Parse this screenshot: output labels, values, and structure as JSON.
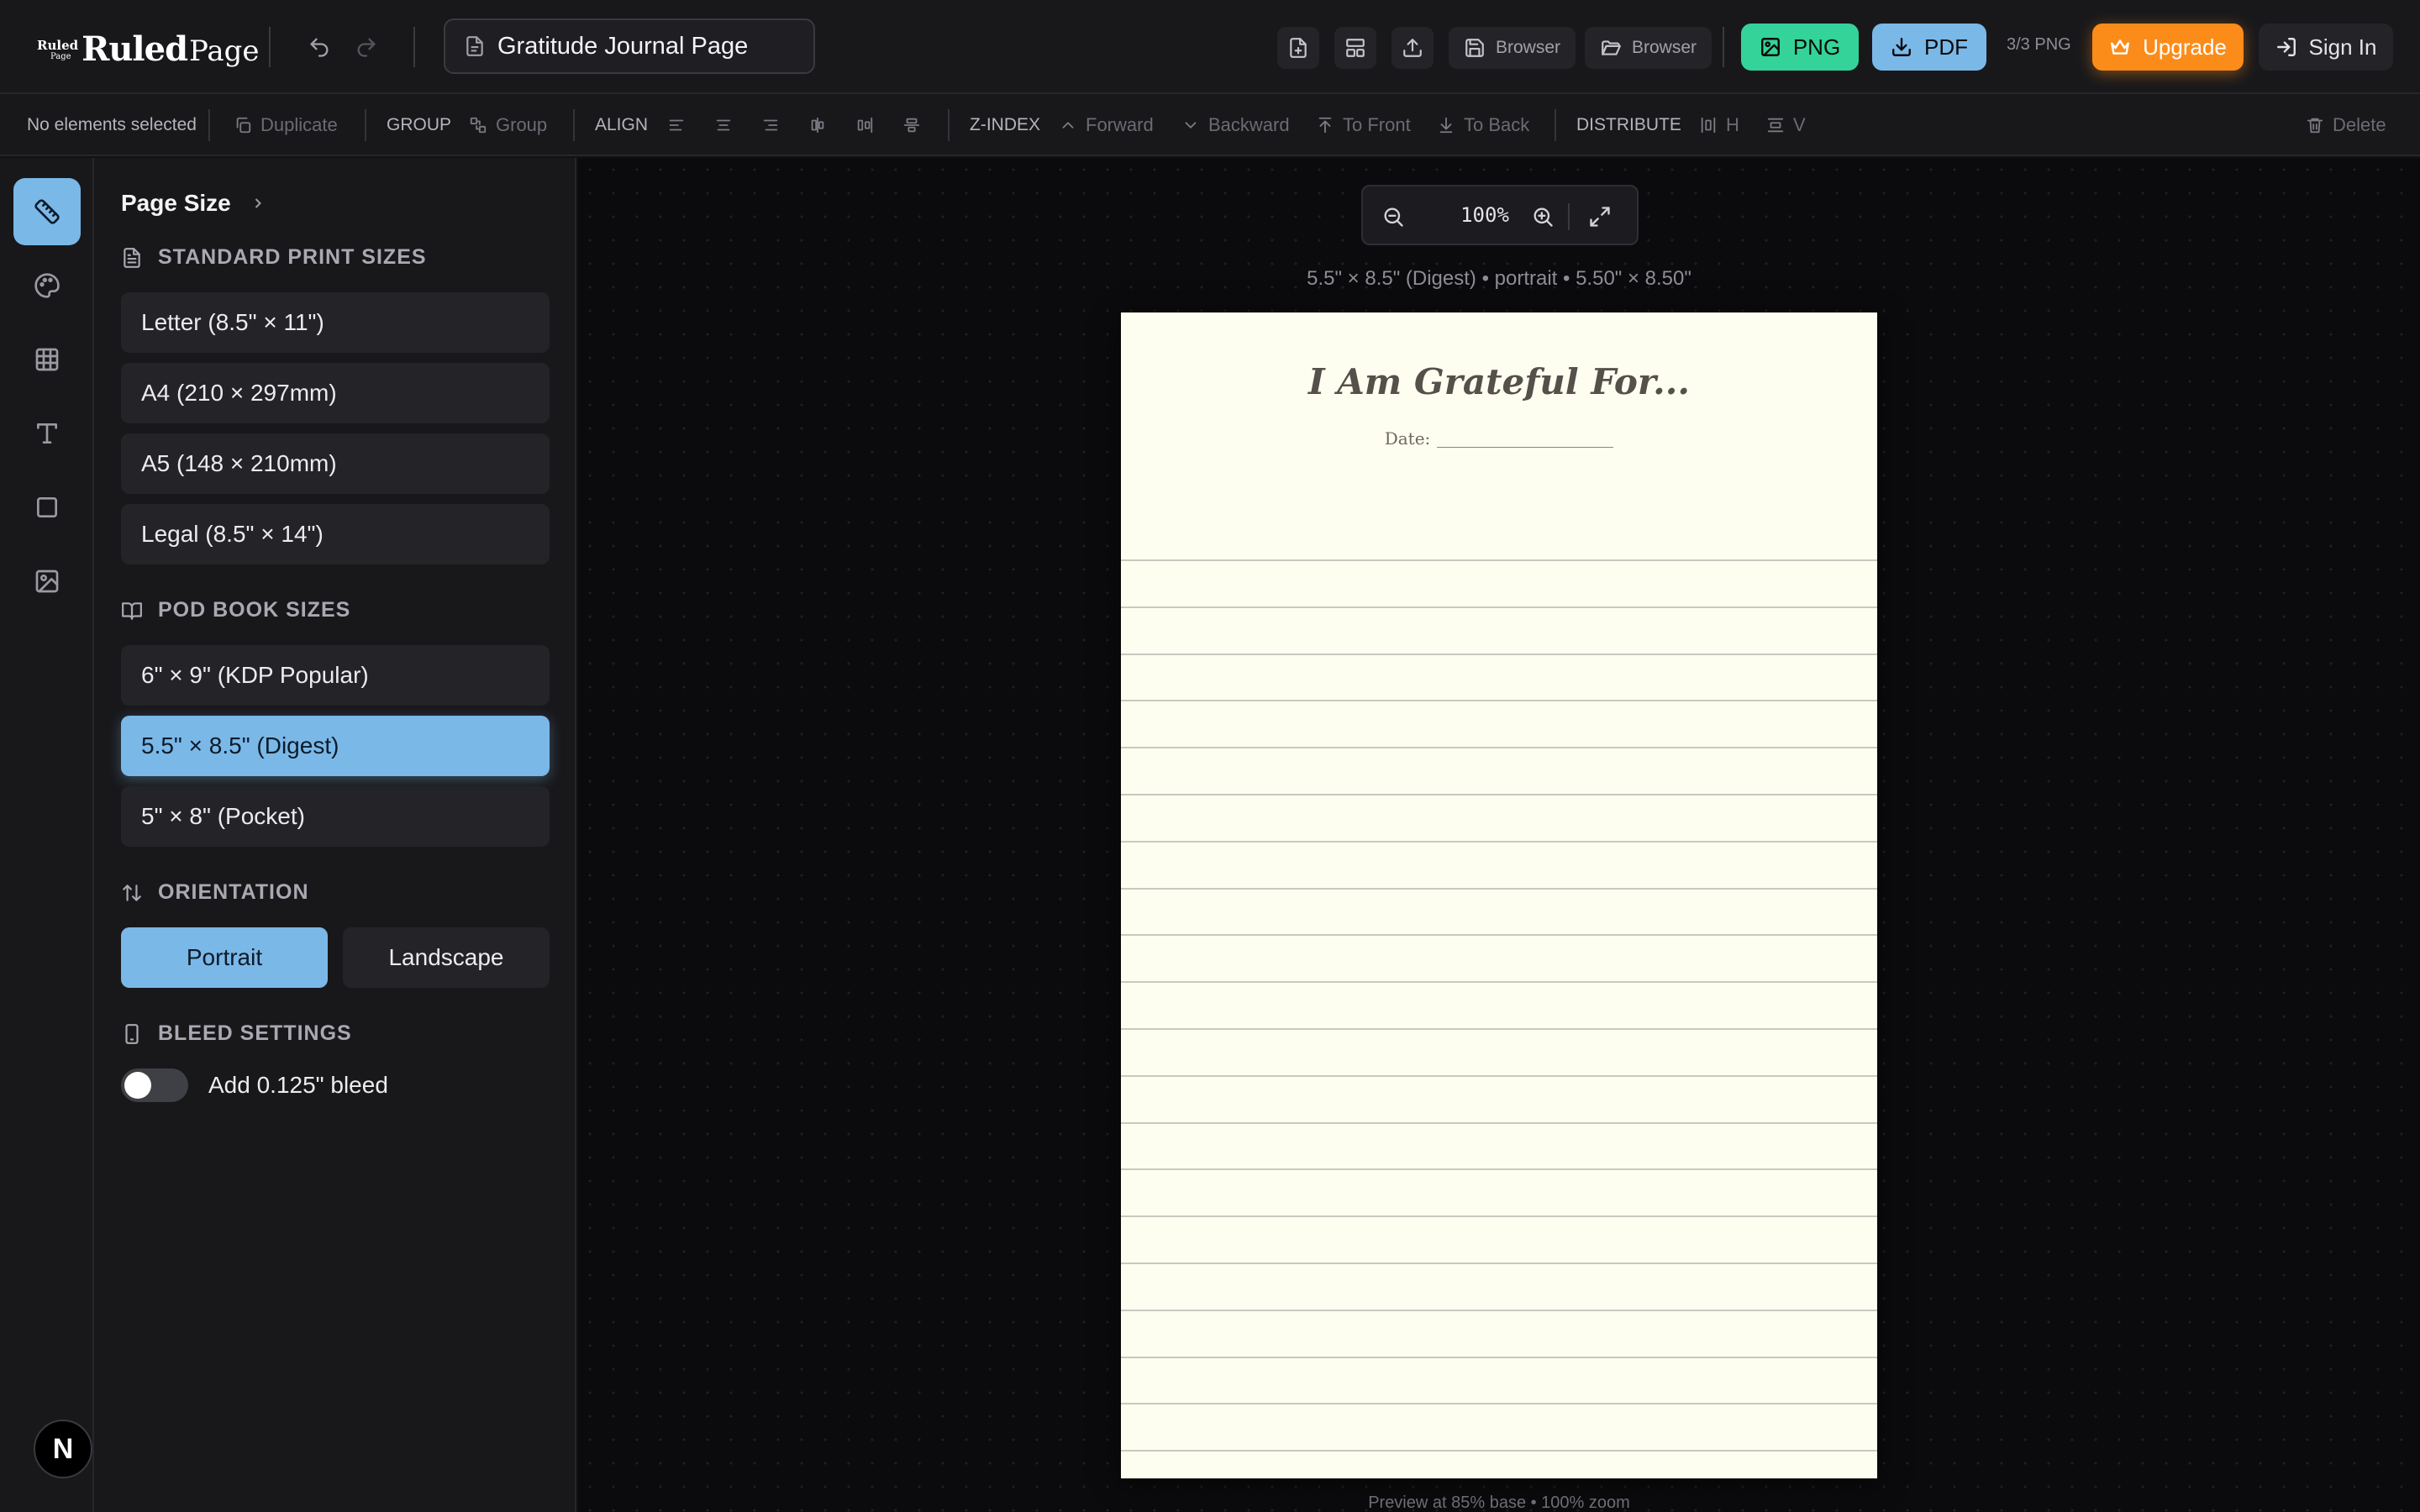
{
  "app": {
    "logo_mark_top": "Ruled",
    "logo_mark_bottom": "Page",
    "logo_word_1": "Ruled",
    "logo_word_2": "Page"
  },
  "document": {
    "name": "Gratitude Journal Page"
  },
  "header": {
    "save_browser_label": "Browser",
    "open_browser_label": "Browser",
    "png_label": "PNG",
    "pdf_label": "PDF",
    "quota": "3/3 PNG",
    "upgrade_label": "Upgrade",
    "signin_label": "Sign In"
  },
  "toolbar": {
    "selection": "No elements selected",
    "duplicate": "Duplicate",
    "group_head": "GROUP",
    "group": "Group",
    "align_head": "ALIGN",
    "zindex_head": "Z-INDEX",
    "forward": "Forward",
    "backward": "Backward",
    "to_front": "To Front",
    "to_back": "To Back",
    "distribute_head": "DISTRIBUTE",
    "dist_h": "H",
    "dist_v": "V",
    "delete": "Delete"
  },
  "panel": {
    "title": "Page Size",
    "standard_heading": "STANDARD PRINT SIZES",
    "standard_sizes": [
      "Letter (8.5\" × 11\")",
      "A4 (210 × 297mm)",
      "A5 (148 × 210mm)",
      "Legal (8.5\" × 14\")"
    ],
    "pod_heading": "POD BOOK SIZES",
    "pod_sizes": [
      "6\" × 9\" (KDP Popular)",
      "5.5\" × 8.5\" (Digest)",
      "5\" × 8\" (Pocket)"
    ],
    "selected_size": "5.5\" × 8.5\" (Digest)",
    "orientation_heading": "ORIENTATION",
    "portrait": "Portrait",
    "landscape": "Landscape",
    "orientation_selected": "Portrait",
    "bleed_heading": "BLEED SETTINGS",
    "bleed_label": "Add 0.125\" bleed",
    "bleed_enabled": false
  },
  "canvas": {
    "zoom": "100%",
    "page_info": "5.5\" × 8.5\" (Digest) • portrait • 5.50\" × 8.50\"",
    "preview_note": "Preview at 85% base • 100% zoom"
  },
  "journal_page": {
    "title": "I Am Grateful For...",
    "date_label": "Date:",
    "ruled_line_count": 20
  },
  "user": {
    "avatar_letter": "N"
  },
  "colors": {
    "accent_blue": "#7ab8e8",
    "png_green": "#34d399",
    "upgrade_orange": "#fb8c1a",
    "page_cream": "#fefef0"
  }
}
